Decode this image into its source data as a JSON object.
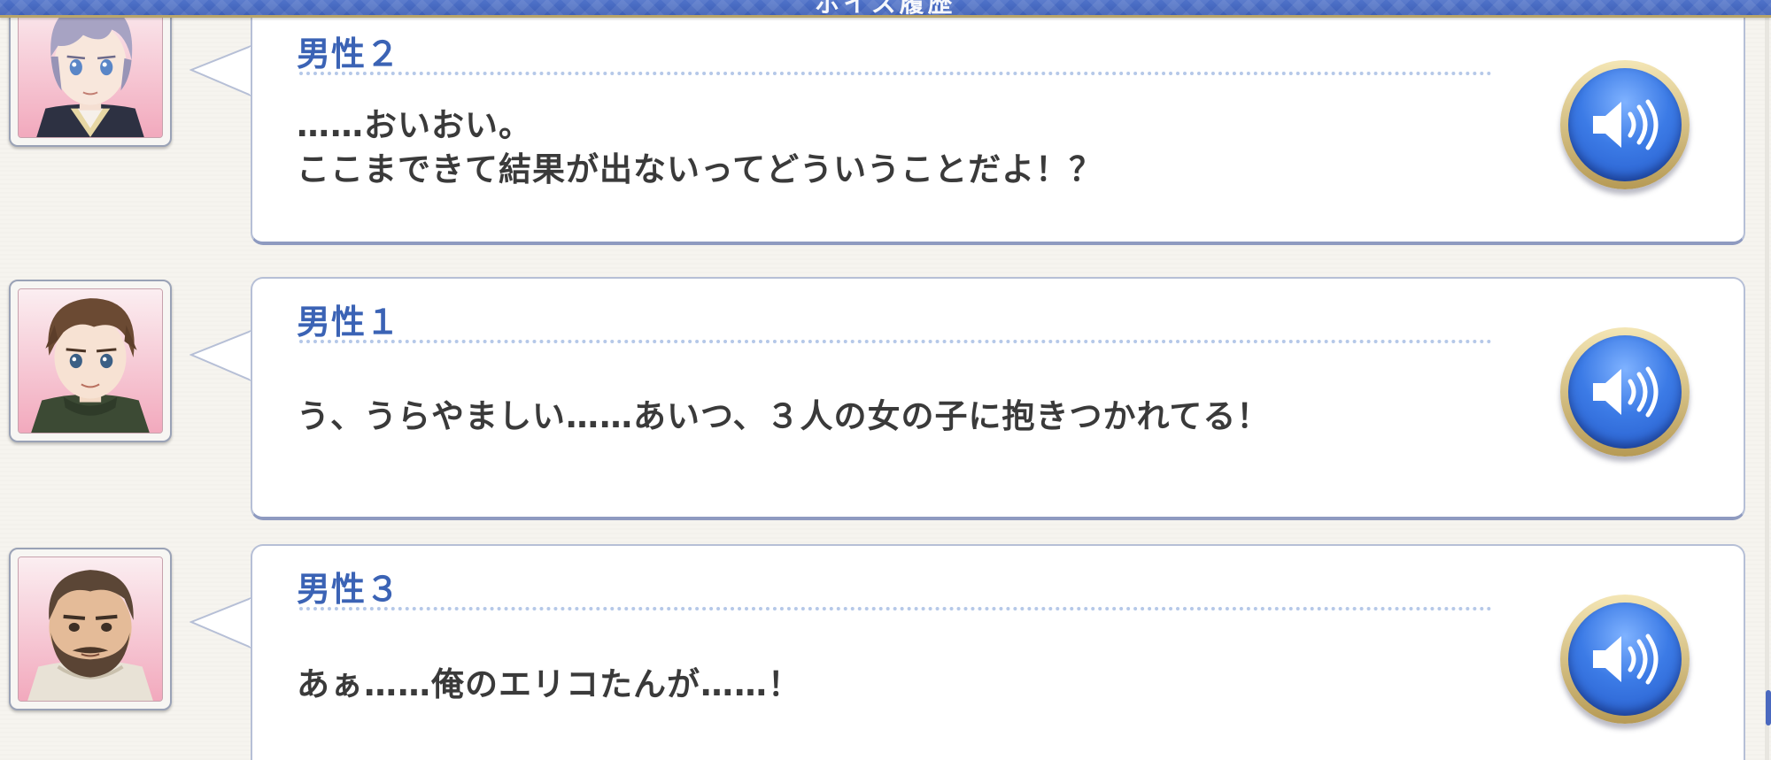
{
  "header": {
    "title": "ボイス履歴"
  },
  "entries": [
    {
      "speaker": "男性２",
      "lines": [
        "……おいおい。",
        "ここまできて結果が出ないってどういうことだよ！？"
      ],
      "portrait": "silver-haired-man-portrait",
      "voice_icon": "speaker-icon"
    },
    {
      "speaker": "男性１",
      "lines": [
        "う、うらやましい……あいつ、３人の女の子に抱きつかれてる！"
      ],
      "portrait": "brown-haired-man-portrait",
      "voice_icon": "speaker-icon"
    },
    {
      "speaker": "男性３",
      "lines": [
        "あぁ……俺のエリコたんが……！"
      ],
      "portrait": "bearded-man-portrait",
      "voice_icon": "speaker-icon"
    }
  ],
  "colors": {
    "header": "#4566bf",
    "speaker_name": "#3b63b5",
    "voice_button": "#3c7be6",
    "background": "#f6f4ef"
  }
}
